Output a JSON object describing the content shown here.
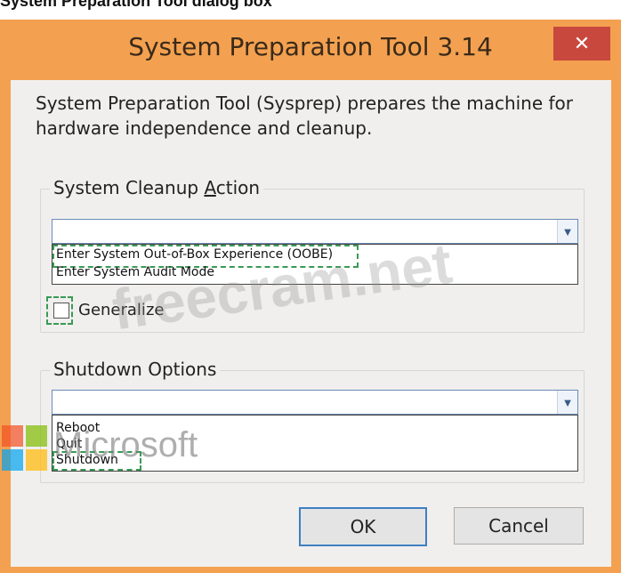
{
  "caption": "System Preparation Tool dialog box",
  "window": {
    "title": "System Preparation Tool 3.14",
    "close_glyph": "✕",
    "description": "System Preparation Tool (Sysprep) prepares the machine for hardware independence and cleanup.",
    "colors": {
      "frame": "#f3a150",
      "close": "#c9483d",
      "client": "#f0efee"
    }
  },
  "cleanup_group": {
    "label_prefix": "System Cleanup ",
    "label_accel": "A",
    "label_suffix": "ction",
    "combo_value": "",
    "arrow_glyph": "▼",
    "options": [
      "Enter System Out-of-Box Experience (OOBE)",
      "Enter System Audit Mode"
    ],
    "generalize_label": "Generalize",
    "generalize_checked": false
  },
  "shutdown_group": {
    "label": "Shutdown Options",
    "combo_value": "",
    "arrow_glyph": "▼",
    "options": [
      "Reboot",
      "Quit",
      "Shutdown"
    ]
  },
  "buttons": {
    "ok": "OK",
    "cancel": "Cancel"
  },
  "overlays": {
    "watermark": "freecram.net",
    "microsoft": "Microsoft",
    "ms_colors": [
      "#f25022",
      "#7fba00",
      "#00a4ef",
      "#ffb900"
    ]
  }
}
